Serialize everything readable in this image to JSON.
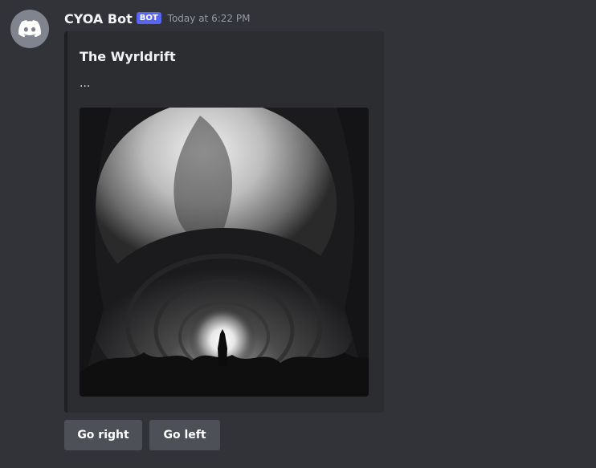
{
  "message": {
    "author": "CYOA Bot",
    "bot_tag": "BOT",
    "timestamp": "Today at 6:22 PM",
    "avatar_icon": "discord-logo-icon"
  },
  "embed": {
    "title": "The Wyrldrift",
    "description": "...",
    "image_description": "grayscale fantasy illustration of a dark tunnel opening onto a bright misty sky, with a glowing portal and silhouetted figure at the end"
  },
  "buttons": [
    {
      "label": "Go right"
    },
    {
      "label": "Go left"
    }
  ],
  "colors": {
    "background": "#313338",
    "embed_background": "#2b2d31",
    "button": "#4e5058",
    "bot_tag": "#5865f2",
    "avatar": "#80848e"
  }
}
